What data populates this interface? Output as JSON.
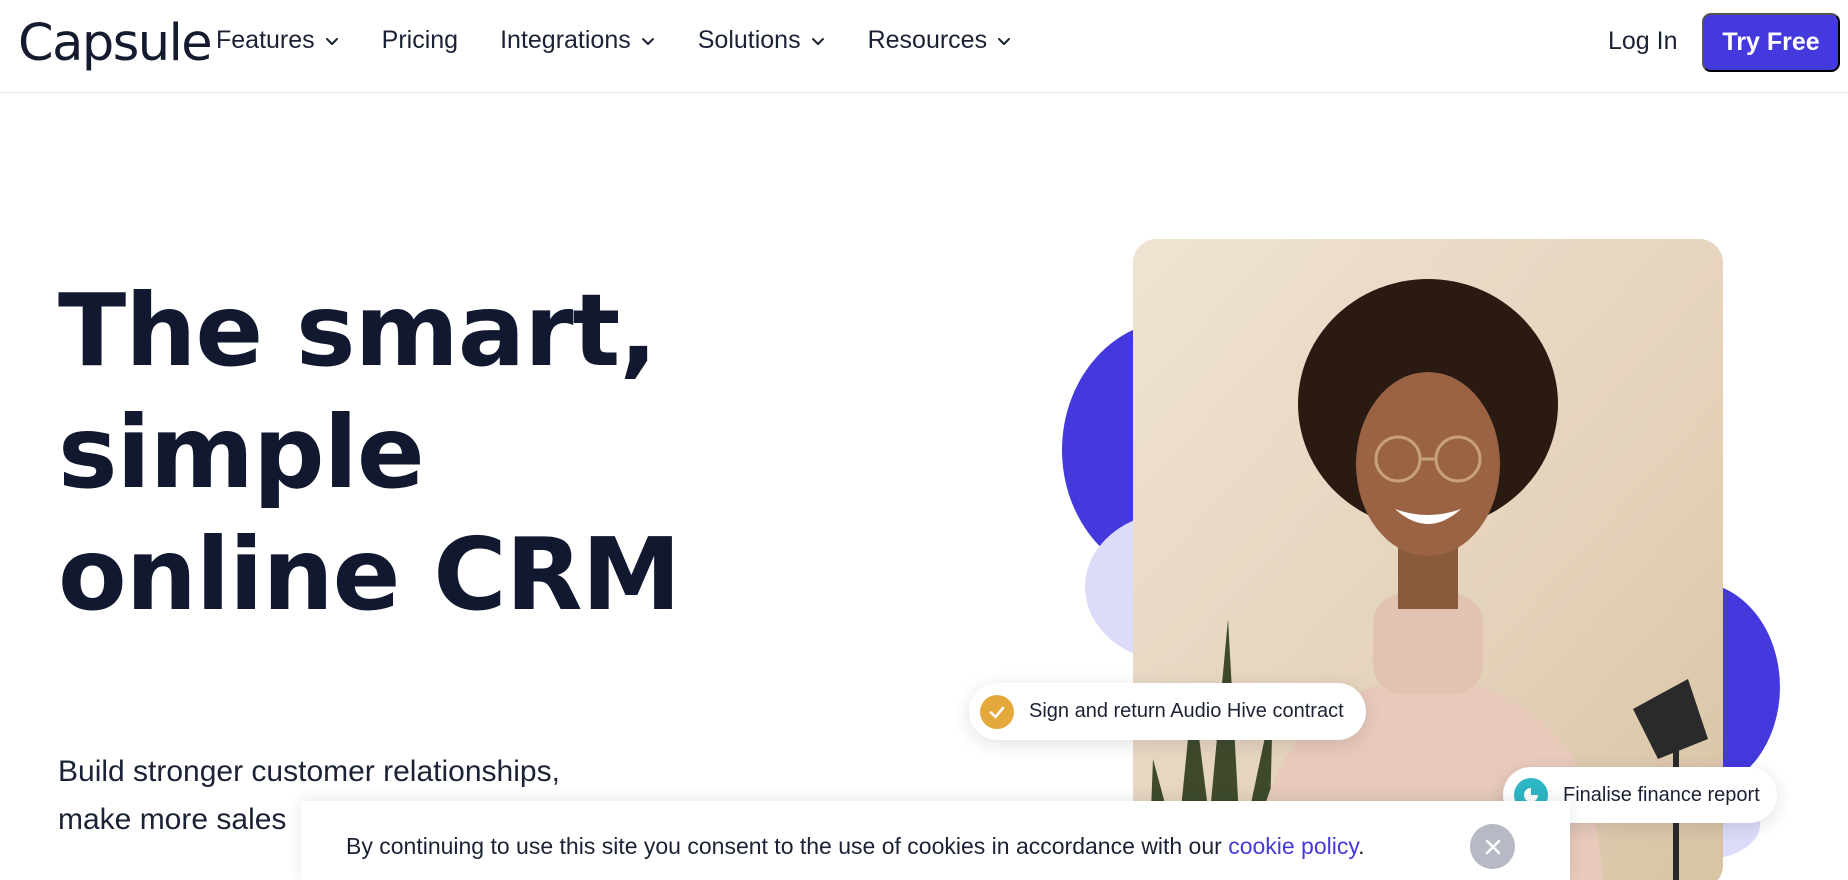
{
  "header": {
    "logo": "Capsule",
    "nav": [
      {
        "label": "Features",
        "icon": "chevron-down-icon"
      },
      {
        "label": "Pricing"
      },
      {
        "label": "Integrations",
        "icon": "chevron-down-icon"
      },
      {
        "label": "Solutions",
        "icon": "chevron-down-icon"
      },
      {
        "label": "Resources",
        "icon": "chevron-down-icon"
      }
    ],
    "login_label": "Log In",
    "cta_label": "Try Free"
  },
  "hero": {
    "headline_line1": "The smart, simple",
    "headline_line2": "online CRM",
    "subline_line1": "Build stronger customer relationships,",
    "subline_line2": "make more sales",
    "tasks": [
      {
        "label": "Sign and return Audio Hive contract",
        "icon": "check-icon"
      },
      {
        "label": "Finalise finance report",
        "icon": "pie-chart-icon"
      }
    ]
  },
  "cookie_banner": {
    "text": "By continuing to use this site you consent to the use of cookies in accordance with our ",
    "link_label": "cookie policy",
    "suffix": ".",
    "close_icon": "close-icon"
  },
  "colors": {
    "brand": "#4439dc",
    "heading": "#11182f",
    "blob_light": "#dcdcfa",
    "check": "#e4a93a",
    "report": "#2db6c4"
  }
}
